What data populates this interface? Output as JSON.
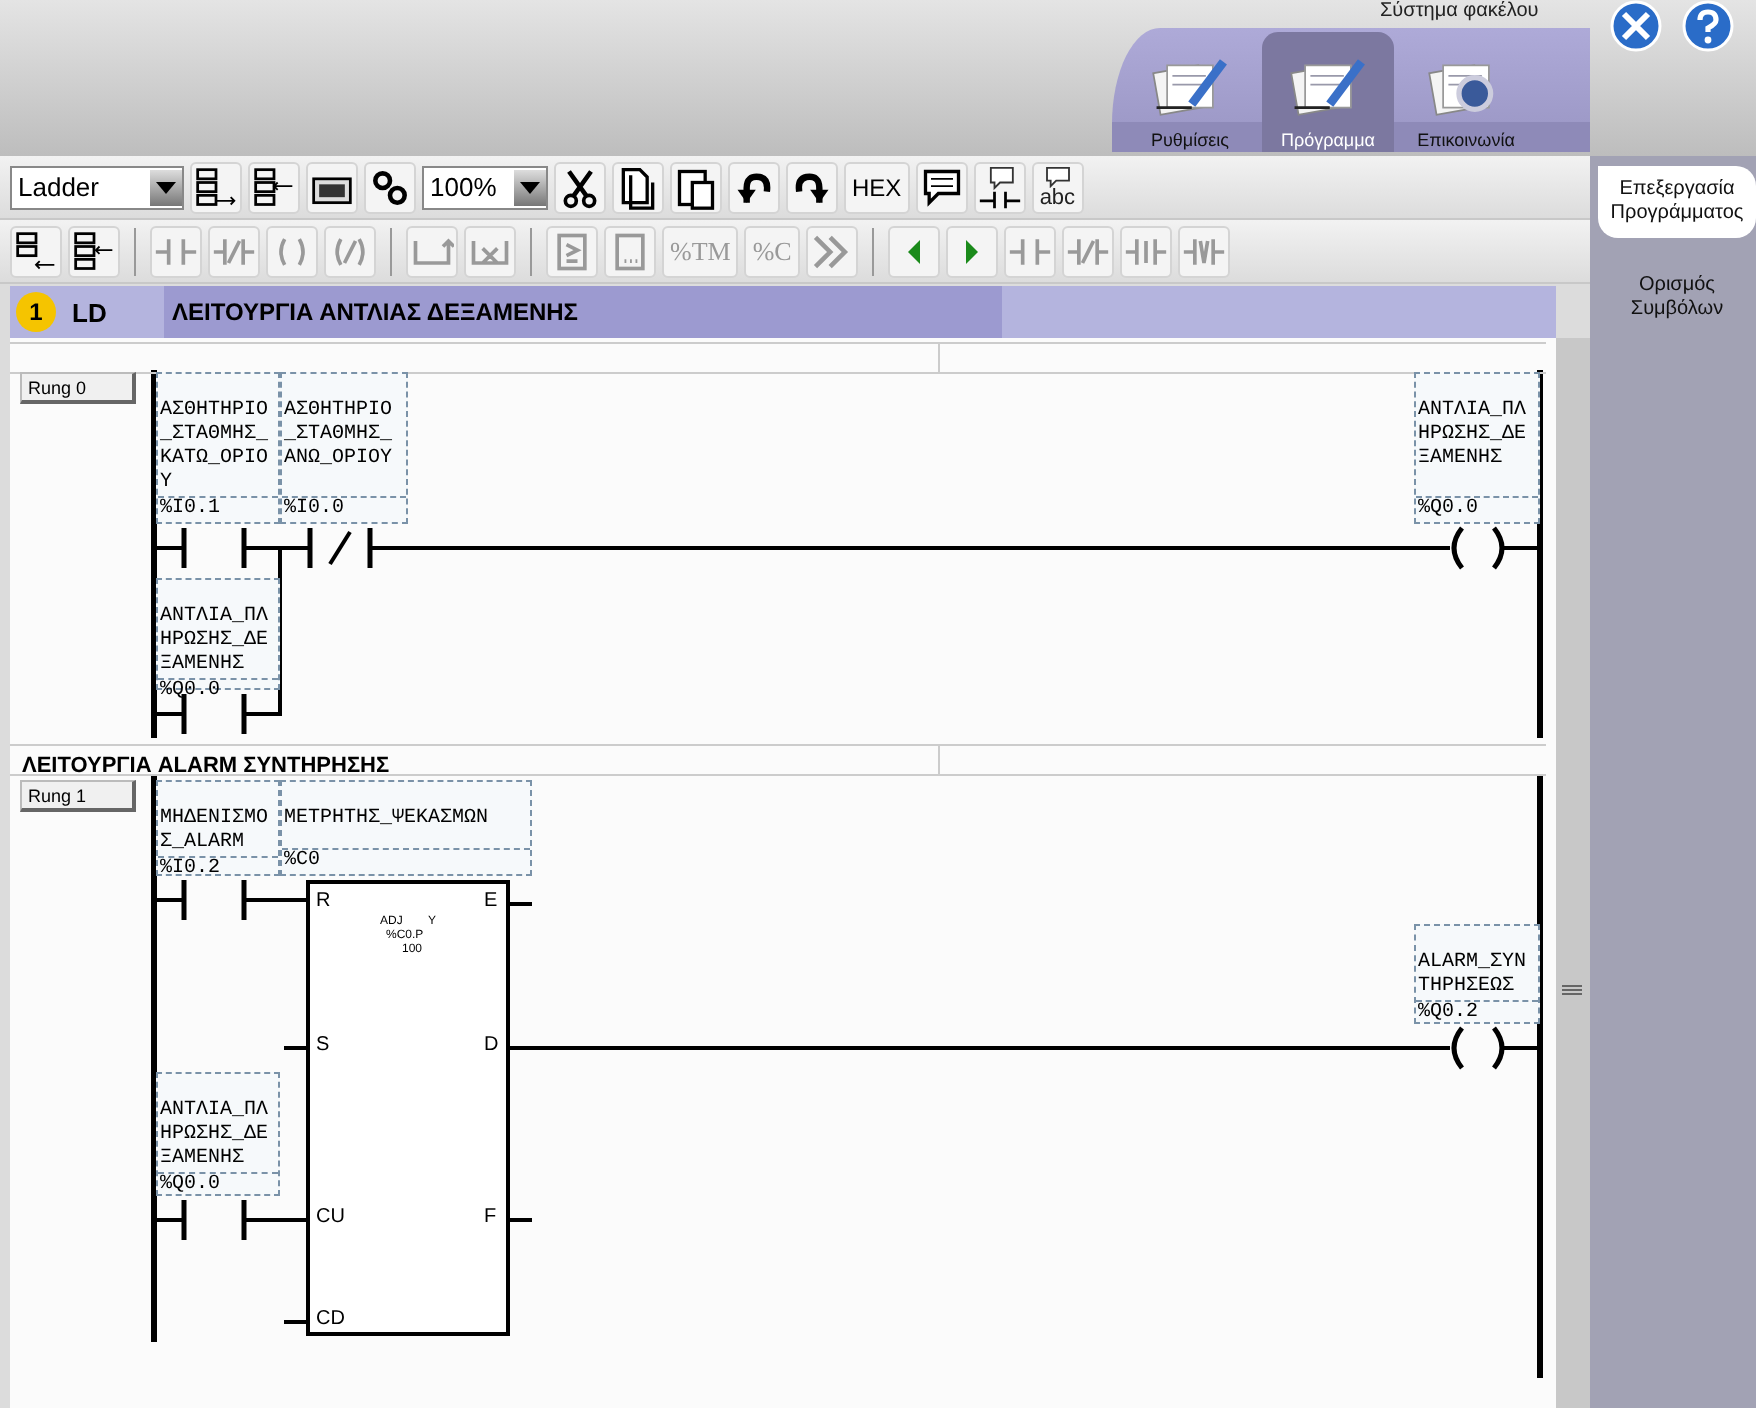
{
  "header": {
    "title": "Σύστημα φακέλου",
    "tabs": [
      {
        "label": "Ρυθμίσεις",
        "selected": false
      },
      {
        "label": "Πρόγραμμα",
        "selected": true
      },
      {
        "label": "Επικοινωνία",
        "selected": false
      }
    ]
  },
  "toolbar": {
    "mode": "Ladder",
    "zoom": "100%",
    "hex": "HEX",
    "comment_label": "abc",
    "text_buttons": [
      {
        "label": "%TM",
        "disabled": true
      },
      {
        "label": "%C",
        "disabled": true
      }
    ]
  },
  "side_tabs": [
    {
      "label": "Επεξεργασία Προγράμματος",
      "selected": true
    },
    {
      "label": "Ορισμός Συμβόλων",
      "selected": false
    }
  ],
  "section": {
    "number": "1",
    "language": "LD",
    "title": "ΛΕΙΤΟΥΡΓΙΑ ΑΝΤΛΙΑΣ ΔΕΞΑΜΕΝΗΣ"
  },
  "rungs": [
    {
      "label": "Rung 0",
      "elements": [
        {
          "kind": "contact_no",
          "symbol": "ΑΣΘΗΤΗΡΙΟ_ΣΤΑΘΜΗΣ_ΚΑΤΩ_ΟΡΙΟΥ",
          "address": "%I0.1"
        },
        {
          "kind": "contact_nc",
          "symbol": "ΑΣΘΗΤΗΡΙΟ_ΣΤΑΘΜΗΣ_ΑΝΩ_ΟΡΙΟΥ",
          "address": "%I0.0"
        },
        {
          "kind": "coil",
          "symbol": "ΑΝΤΛΙΑ_ΠΛΗΡΩΣΗΣ_ΔΕΞΑΜΕΝΗΣ",
          "address": "%Q0.0"
        },
        {
          "kind": "contact_no",
          "symbol": "ΑΝΤΛΙΑ_ΠΛΗΡΩΣΗΣ_ΔΕΞΑΜΕΝΗΣ",
          "address": "%Q0.0"
        }
      ]
    },
    {
      "comment": "ΛΕΙΤΟΥΡΓΙΑ ALARM ΣΥΝΤΗΡΗΣΗΣ",
      "label": "Rung 1",
      "elements": [
        {
          "kind": "contact_no",
          "symbol": "ΜΗΔΕΝΙΣΜΟΣ_ALARM",
          "address": "%I0.2"
        },
        {
          "kind": "counter",
          "symbol": "ΜΕΤΡΗΤΗΣ_ΨΕΚΑΣΜΩΝ",
          "address": "%C0",
          "inputs": [
            "R",
            "S",
            "CU",
            "CD"
          ],
          "outputs": [
            "E",
            "D",
            "F"
          ],
          "params": [
            "ADJ",
            "Y",
            "%C0.P",
            "100"
          ]
        },
        {
          "kind": "coil",
          "symbol": "ALARM_ΣΥΝΤΗΡΗΣΕΩΣ",
          "address": "%Q0.2"
        },
        {
          "kind": "contact_no",
          "symbol": "ΑΝΤΛΙΑ_ΠΛΗΡΩΣΗΣ_ΔΕΞΑΜΕΝΗΣ",
          "address": "%Q0.0"
        }
      ]
    }
  ]
}
